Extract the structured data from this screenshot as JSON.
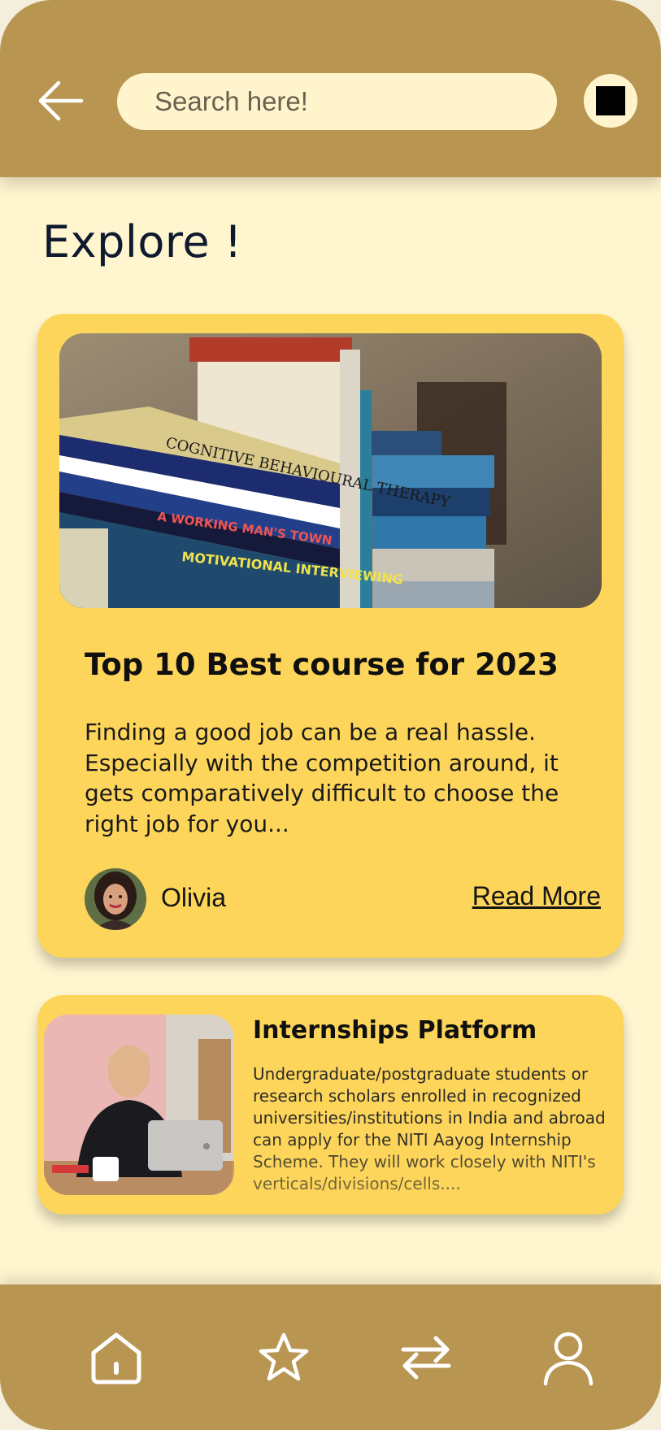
{
  "search": {
    "placeholder": "Search here!"
  },
  "page": {
    "title": "Explore !"
  },
  "featured_card": {
    "title": "Top 10 Best course for 2023",
    "description": "Finding a good job can be a real hassle. Especially with the competition around, it gets comparatively difficult to choose the right job for you...",
    "author": "Olivia",
    "read_more_label": "Read More",
    "image_icon": "books-photo"
  },
  "internship_card": {
    "title": "Internships Platform",
    "description": "Undergraduate/postgraduate students or research scholars enrolled in recognized universities/institutions in India and abroad can apply for the NITI Aayog Internship Scheme. They will work closely with NITI's verticals/divisions/cells....",
    "image_icon": "woman-with-laptop-photo"
  },
  "nav": {
    "items": [
      "home-icon",
      "star-icon",
      "swap-arrows-icon",
      "profile-icon"
    ]
  },
  "colors": {
    "bar": "#b89652",
    "background": "#fff6cf",
    "card": "#fdd55a",
    "search_field": "#fff4cc"
  }
}
